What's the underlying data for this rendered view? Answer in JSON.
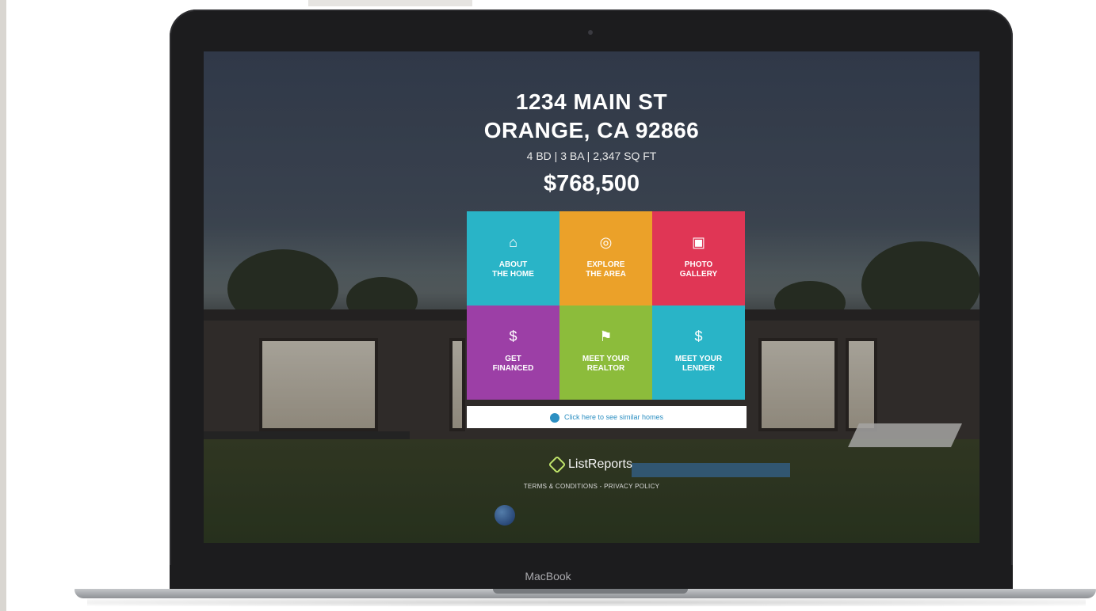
{
  "listing": {
    "address_line1": "1234 MAIN ST",
    "address_line2": "ORANGE, CA 92866",
    "specs": "4 BD | 3 BA | 2,347 SQ FT",
    "price": "$768,500"
  },
  "tiles": [
    {
      "icon": "home-icon",
      "glyph": "⌂",
      "label_line1": "ABOUT",
      "label_line2": "THE HOME",
      "color": "#29b4c7"
    },
    {
      "icon": "compass-icon",
      "glyph": "◎",
      "label_line1": "EXPLORE",
      "label_line2": "THE AREA",
      "color": "#eba129"
    },
    {
      "icon": "photo-gallery-icon",
      "glyph": "▣",
      "label_line1": "PHOTO",
      "label_line2": "GALLERY",
      "color": "#e03655"
    },
    {
      "icon": "money-icon",
      "glyph": "$",
      "label_line1": "GET",
      "label_line2": "FINANCED",
      "color": "#9c3fa6"
    },
    {
      "icon": "realtor-sign-icon",
      "glyph": "⚑",
      "label_line1": "MEET YOUR",
      "label_line2": "REALTOR",
      "color": "#8cbc3b"
    },
    {
      "icon": "lender-dollar-icon",
      "glyph": "$",
      "label_line1": "MEET YOUR",
      "label_line2": "LENDER",
      "color": "#29b4c7"
    }
  ],
  "similar_homes": {
    "icon": "similar-homes-icon",
    "label": "Click here to see similar homes"
  },
  "footer": {
    "brand": "ListReports",
    "terms": "TERMS & CONDITIONS",
    "separator": "-",
    "privacy": "PRIVACY POLICY"
  },
  "device": {
    "label": "MacBook"
  }
}
